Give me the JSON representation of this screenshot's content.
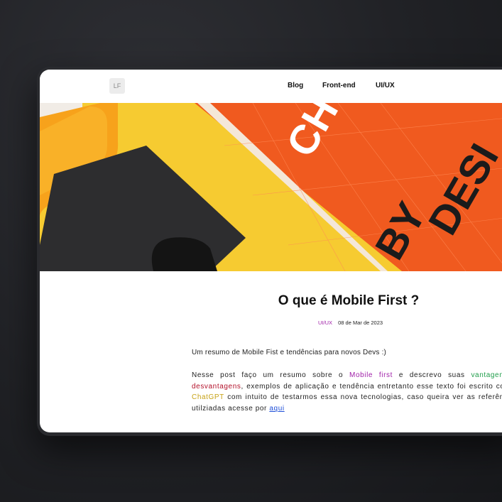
{
  "header": {
    "logo": "LF",
    "nav": [
      "Blog",
      "Front-end",
      "UI/UX"
    ]
  },
  "hero_image": {
    "book_title_words": [
      "CH",
      "BY",
      "DESI"
    ]
  },
  "post": {
    "title": "O que é Mobile First ?",
    "tag": "UI/UX",
    "date": "08 de Mar de 2023",
    "summary": "Um resumo de Mobile Fist e tendências para novos Devs :)",
    "body": {
      "p1": "Nesse post faço um resumo sobre o ",
      "h1": "Mobile first",
      "p2": " e descrevo suas ",
      "h2": "vantagens",
      "p3": " e ",
      "h3": "desvantagens",
      "p4": ", exemplos de aplicação e tendência entretanto esse texto foi escrito com o ",
      "h4": "ChatGPT",
      "p5": " com intuito de testarmos essa nova tecnologias, caso queira ver as referências utilziadas acesse por ",
      "link": "aqui"
    }
  },
  "colors": {
    "accent_purple": "#a020a8",
    "accent_green": "#1f9d4a",
    "accent_red": "#b3112a",
    "accent_yellow": "#c7a215",
    "link_blue": "#1d4ed8"
  }
}
